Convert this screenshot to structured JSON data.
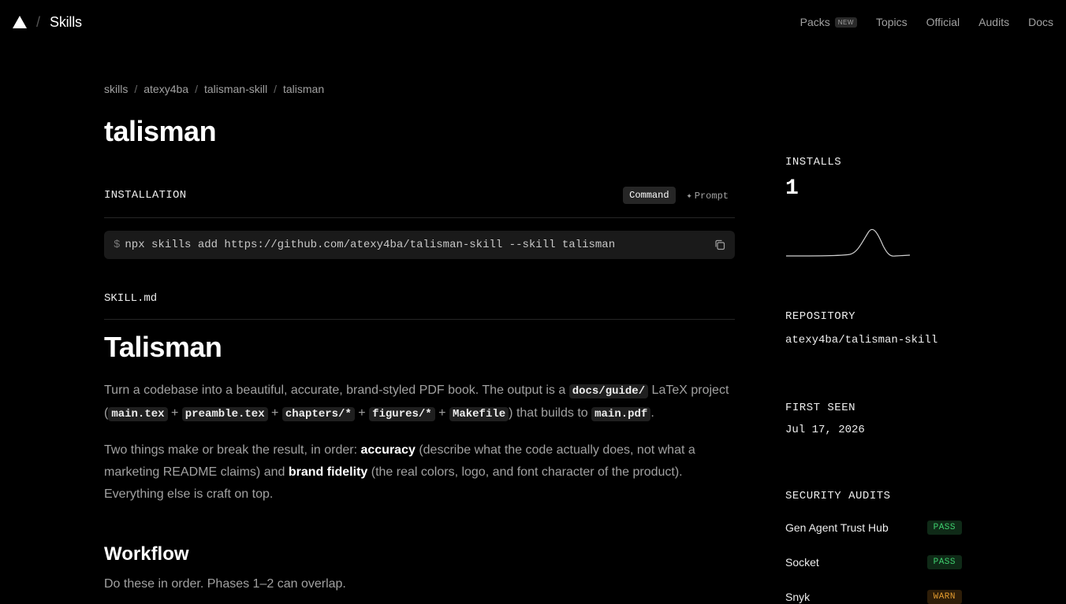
{
  "nav": {
    "brand": "Skills",
    "separator": "/",
    "links": [
      {
        "label": "Packs",
        "badge": "NEW"
      },
      {
        "label": "Topics"
      },
      {
        "label": "Official"
      },
      {
        "label": "Audits"
      },
      {
        "label": "Docs"
      }
    ]
  },
  "breadcrumb": [
    "skills",
    "atexy4ba",
    "talisman-skill",
    "talisman"
  ],
  "breadcrumb_separator": "/",
  "title": "talisman",
  "installation": {
    "label": "INSTALLATION",
    "modes": [
      {
        "label": "Command",
        "active": true
      },
      {
        "label": "Prompt",
        "active": false
      }
    ],
    "prompt_symbol": "$",
    "command": "npx skills add https://github.com/atexy4ba/talisman-skill --skill talisman"
  },
  "file": {
    "label": "SKILL.md",
    "h1": "Talisman",
    "p1": {
      "t1": "Turn a codebase into a beautiful, accurate, brand-styled PDF book. The output is a ",
      "c1": "docs/guide/",
      "t2": " LaTeX project (",
      "c2": "main.tex",
      "t3": " + ",
      "c3": "preamble.tex",
      "t4": " + ",
      "c4": "chapters/*",
      "t5": " + ",
      "c5": "figures/*",
      "t6": " + ",
      "c6": "Makefile",
      "t7": ") that builds to ",
      "c7": "main.pdf",
      "t8": "."
    },
    "p2": {
      "t1": "Two things make or break the result, in order: ",
      "b1": "accuracy",
      "t2": " (describe what the code actually does, not what a marketing README claims) and ",
      "b2": "brand fidelity",
      "t3": " (the real colors, logo, and font character of the product). Everything else is craft on top."
    },
    "h2": "Workflow",
    "p3": "Do these in order. Phases 1–2 can overlap."
  },
  "sidebar": {
    "installs_label": "INSTALLS",
    "installs_value": "1",
    "repository_label": "REPOSITORY",
    "repository_value": "atexy4ba/talisman-skill",
    "first_seen_label": "FIRST SEEN",
    "first_seen_value": "Jul 17, 2026",
    "audits_label": "SECURITY AUDITS",
    "audits": [
      {
        "name": "Gen Agent Trust Hub",
        "status": "PASS"
      },
      {
        "name": "Socket",
        "status": "PASS"
      },
      {
        "name": "Snyk",
        "status": "WARN"
      }
    ]
  },
  "colors": {
    "pass": "#3ecf6e",
    "warn": "#e29a2e",
    "background": "#000000"
  },
  "icons": {
    "logo": "triangle-logo-icon",
    "copy": "copy-icon",
    "prompt": "sparkle-icon"
  }
}
